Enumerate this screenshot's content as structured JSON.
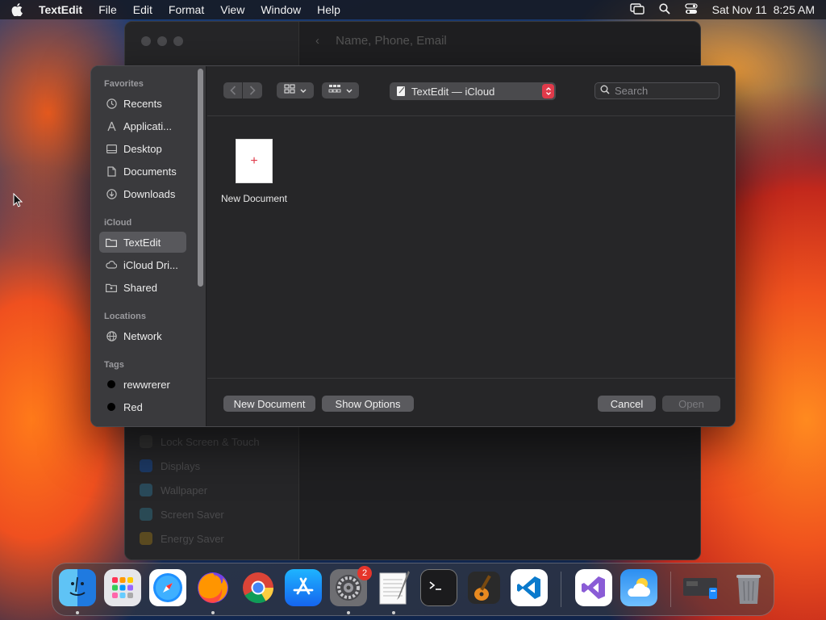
{
  "menubar": {
    "app_name": "TextEdit",
    "menus": [
      "File",
      "Edit",
      "Format",
      "View",
      "Window",
      "Help"
    ],
    "datetime": "Sat Nov 11  8:25 AM"
  },
  "background_window": {
    "header_text": "Name, Phone, Email",
    "sidebar_items": [
      "Lock Screen & Touch",
      "Displays",
      "Wallpaper",
      "Screen Saver",
      "Energy Saver"
    ]
  },
  "dialog": {
    "sidebar": {
      "favorites_label": "Favorites",
      "favorites": [
        "Recents",
        "Applicati...",
        "Desktop",
        "Documents",
        "Downloads"
      ],
      "icloud_label": "iCloud",
      "icloud": [
        "TextEdit",
        "iCloud Dri...",
        "Shared"
      ],
      "locations_label": "Locations",
      "locations": [
        "Network"
      ],
      "tags_label": "Tags",
      "tags": [
        "rewwrerer",
        "Red"
      ]
    },
    "location": "TextEdit — iCloud",
    "search_placeholder": "Search",
    "files": [
      {
        "name": "New Document"
      }
    ],
    "buttons": {
      "new_document": "New Document",
      "show_options": "Show Options",
      "cancel": "Cancel",
      "open": "Open"
    }
  },
  "dock": {
    "apps": [
      "Finder",
      "Launchpad",
      "Safari",
      "Firefox",
      "Chrome",
      "App Store",
      "System Settings",
      "TextEdit",
      "Terminal",
      "GarageBand",
      "VS Code",
      "Visual Studio",
      "Weather",
      "Downloads",
      "Trash"
    ],
    "settings_badge": "2"
  },
  "colors": {
    "accent_red": "#e03a4a",
    "dialog_bg": "#252528",
    "sidebar_bg": "#3a3a3d"
  }
}
